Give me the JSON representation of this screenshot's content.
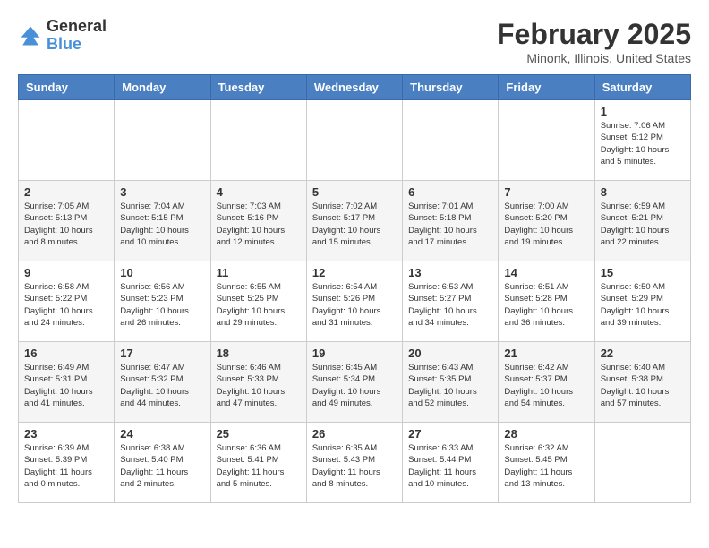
{
  "header": {
    "logo_general": "General",
    "logo_blue": "Blue",
    "month_title": "February 2025",
    "location": "Minonk, Illinois, United States"
  },
  "weekdays": [
    "Sunday",
    "Monday",
    "Tuesday",
    "Wednesday",
    "Thursday",
    "Friday",
    "Saturday"
  ],
  "weeks": [
    [
      {
        "day": "",
        "info": ""
      },
      {
        "day": "",
        "info": ""
      },
      {
        "day": "",
        "info": ""
      },
      {
        "day": "",
        "info": ""
      },
      {
        "day": "",
        "info": ""
      },
      {
        "day": "",
        "info": ""
      },
      {
        "day": "1",
        "info": "Sunrise: 7:06 AM\nSunset: 5:12 PM\nDaylight: 10 hours\nand 5 minutes."
      }
    ],
    [
      {
        "day": "2",
        "info": "Sunrise: 7:05 AM\nSunset: 5:13 PM\nDaylight: 10 hours\nand 8 minutes."
      },
      {
        "day": "3",
        "info": "Sunrise: 7:04 AM\nSunset: 5:15 PM\nDaylight: 10 hours\nand 10 minutes."
      },
      {
        "day": "4",
        "info": "Sunrise: 7:03 AM\nSunset: 5:16 PM\nDaylight: 10 hours\nand 12 minutes."
      },
      {
        "day": "5",
        "info": "Sunrise: 7:02 AM\nSunset: 5:17 PM\nDaylight: 10 hours\nand 15 minutes."
      },
      {
        "day": "6",
        "info": "Sunrise: 7:01 AM\nSunset: 5:18 PM\nDaylight: 10 hours\nand 17 minutes."
      },
      {
        "day": "7",
        "info": "Sunrise: 7:00 AM\nSunset: 5:20 PM\nDaylight: 10 hours\nand 19 minutes."
      },
      {
        "day": "8",
        "info": "Sunrise: 6:59 AM\nSunset: 5:21 PM\nDaylight: 10 hours\nand 22 minutes."
      }
    ],
    [
      {
        "day": "9",
        "info": "Sunrise: 6:58 AM\nSunset: 5:22 PM\nDaylight: 10 hours\nand 24 minutes."
      },
      {
        "day": "10",
        "info": "Sunrise: 6:56 AM\nSunset: 5:23 PM\nDaylight: 10 hours\nand 26 minutes."
      },
      {
        "day": "11",
        "info": "Sunrise: 6:55 AM\nSunset: 5:25 PM\nDaylight: 10 hours\nand 29 minutes."
      },
      {
        "day": "12",
        "info": "Sunrise: 6:54 AM\nSunset: 5:26 PM\nDaylight: 10 hours\nand 31 minutes."
      },
      {
        "day": "13",
        "info": "Sunrise: 6:53 AM\nSunset: 5:27 PM\nDaylight: 10 hours\nand 34 minutes."
      },
      {
        "day": "14",
        "info": "Sunrise: 6:51 AM\nSunset: 5:28 PM\nDaylight: 10 hours\nand 36 minutes."
      },
      {
        "day": "15",
        "info": "Sunrise: 6:50 AM\nSunset: 5:29 PM\nDaylight: 10 hours\nand 39 minutes."
      }
    ],
    [
      {
        "day": "16",
        "info": "Sunrise: 6:49 AM\nSunset: 5:31 PM\nDaylight: 10 hours\nand 41 minutes."
      },
      {
        "day": "17",
        "info": "Sunrise: 6:47 AM\nSunset: 5:32 PM\nDaylight: 10 hours\nand 44 minutes."
      },
      {
        "day": "18",
        "info": "Sunrise: 6:46 AM\nSunset: 5:33 PM\nDaylight: 10 hours\nand 47 minutes."
      },
      {
        "day": "19",
        "info": "Sunrise: 6:45 AM\nSunset: 5:34 PM\nDaylight: 10 hours\nand 49 minutes."
      },
      {
        "day": "20",
        "info": "Sunrise: 6:43 AM\nSunset: 5:35 PM\nDaylight: 10 hours\nand 52 minutes."
      },
      {
        "day": "21",
        "info": "Sunrise: 6:42 AM\nSunset: 5:37 PM\nDaylight: 10 hours\nand 54 minutes."
      },
      {
        "day": "22",
        "info": "Sunrise: 6:40 AM\nSunset: 5:38 PM\nDaylight: 10 hours\nand 57 minutes."
      }
    ],
    [
      {
        "day": "23",
        "info": "Sunrise: 6:39 AM\nSunset: 5:39 PM\nDaylight: 11 hours\nand 0 minutes."
      },
      {
        "day": "24",
        "info": "Sunrise: 6:38 AM\nSunset: 5:40 PM\nDaylight: 11 hours\nand 2 minutes."
      },
      {
        "day": "25",
        "info": "Sunrise: 6:36 AM\nSunset: 5:41 PM\nDaylight: 11 hours\nand 5 minutes."
      },
      {
        "day": "26",
        "info": "Sunrise: 6:35 AM\nSunset: 5:43 PM\nDaylight: 11 hours\nand 8 minutes."
      },
      {
        "day": "27",
        "info": "Sunrise: 6:33 AM\nSunset: 5:44 PM\nDaylight: 11 hours\nand 10 minutes."
      },
      {
        "day": "28",
        "info": "Sunrise: 6:32 AM\nSunset: 5:45 PM\nDaylight: 11 hours\nand 13 minutes."
      },
      {
        "day": "",
        "info": ""
      }
    ]
  ]
}
